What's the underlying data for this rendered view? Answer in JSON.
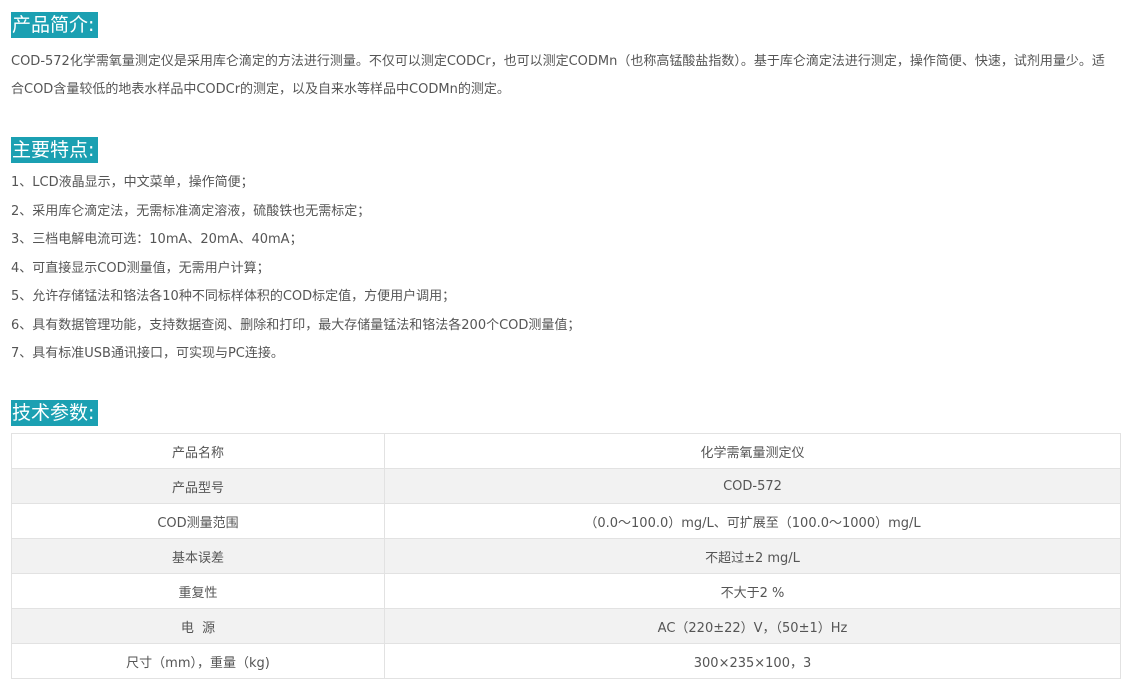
{
  "intro": {
    "title": "产品简介:",
    "text": "COD-572化学需氧量测定仪是采用库仑滴定的方法进行测量。不仅可以测定CODCr，也可以测定CODMn（也称高锰酸盐指数）。基于库仑滴定法进行测定，操作简便、快速，试剂用量少。适合COD含量较低的地表水样品中CODCr的测定，以及自来水等样品中CODMn的测定。"
  },
  "features": {
    "title": "主要特点:",
    "items": [
      "1、LCD液晶显示，中文菜单，操作简便；",
      "2、采用库仑滴定法，无需标准滴定溶液，硫酸铁也无需标定；",
      "3、三档电解电流可选：10mA、20mA、40mA；",
      "4、可直接显示COD测量值，无需用户计算；",
      "5、允许存储锰法和铬法各10种不同标样体积的COD标定值，方便用户调用；",
      "6、具有数据管理功能，支持数据查阅、删除和打印，最大存储量锰法和铬法各200个COD测量值；",
      "7、具有标准USB通讯接口，可实现与PC连接。"
    ]
  },
  "specs": {
    "title": "技术参数:",
    "rows": [
      {
        "key": "产品名称",
        "value": "化学需氧量测定仪"
      },
      {
        "key": "产品型号",
        "value": "COD-572"
      },
      {
        "key": "COD测量范围",
        "value": "（0.0～100.0）mg/L、可扩展至（100.0～1000）mg/L"
      },
      {
        "key": "基本误差",
        "value": "不超过±2 mg/L"
      },
      {
        "key": "重复性",
        "value": "不大于2 %"
      },
      {
        "key": "电  源",
        "value": "AC（220±22）V，（50±1）Hz"
      },
      {
        "key": "尺寸（mm），重量（kg)",
        "value": "300×235×100，3"
      }
    ]
  }
}
